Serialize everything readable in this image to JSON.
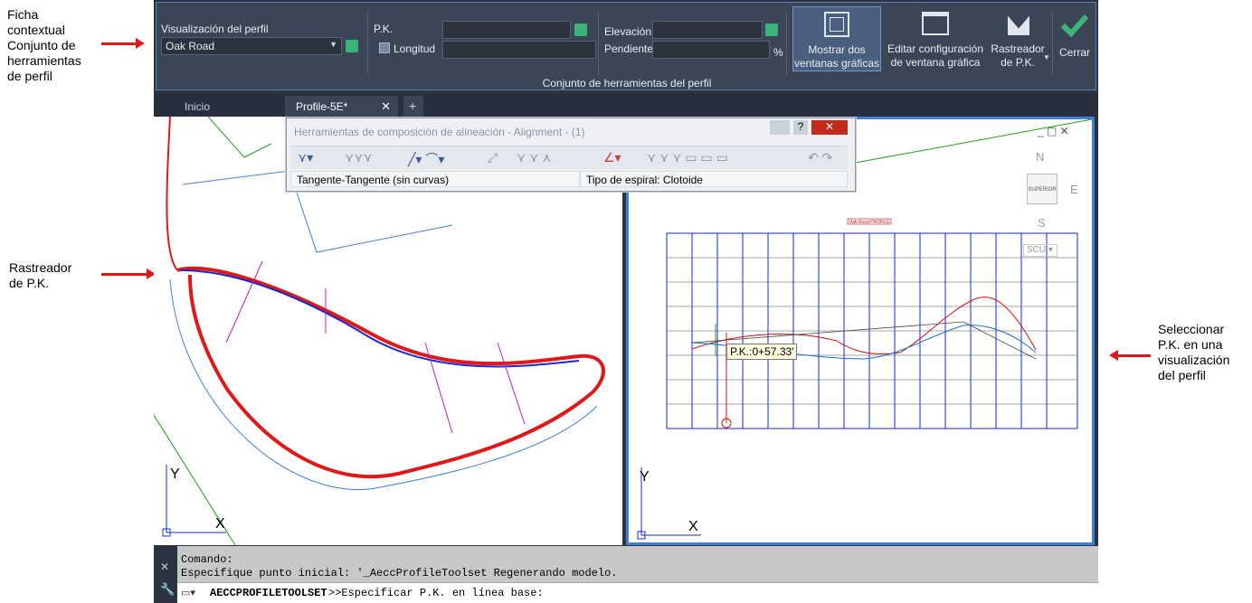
{
  "annotations": {
    "context_tab": "Ficha\ncontextual\nConjunto de\nherramientas\nde perfil",
    "station_tracker": "Rastreador\nde P.K.",
    "select_station": "Seleccionar\nP.K. en una\nvisualización\ndel perfil"
  },
  "ribbon": {
    "profile_view_label": "Visualización del perfil",
    "profile_view_value": "Oak Road",
    "station_label": "P.K.",
    "length_label": "Longitud",
    "elevation_label": "Elevación",
    "grade_label": "Pendiente",
    "grade_unit": "%",
    "show_two_viewports": "Mostrar dos\nventanas gráficas",
    "edit_viewport": "Editar configuración\nde ventana gráfica",
    "station_tracker": "Rastreador\nde P.K.",
    "close": "Cerrar",
    "panel_title": "Conjunto de herramientas del perfil"
  },
  "tabs": [
    {
      "label": "Inicio"
    },
    {
      "label": "Profile-5E*"
    }
  ],
  "toolbar": {
    "title": "Herramientas de composición de alineación - Alignment - (1)",
    "left_status": "Tangente-Tangente (sin curvas)",
    "right_status": "Tipo de espiral: Clotoide"
  },
  "viewcube": {
    "top": "SUPERIOR",
    "north": "N",
    "south": "S",
    "east": "E",
    "ucs": "SCU"
  },
  "station_tooltip": "P.K.:0+57.33'",
  "profile_title": "Oak Road PROFILE",
  "axes": {
    "y": "Y",
    "x": "X"
  },
  "command": {
    "line1": "Comando:",
    "line2": "Especifique punto inicial: '_AeccProfileToolset Regenerando modelo.",
    "prompt_cmd": "AECCPROFILETOOLSET",
    "prompt_text": " >>Especificar P.K. en línea base:"
  },
  "colors": {
    "accent": "#3f80d8",
    "annotation_arrow": "#e01818",
    "ribbon_bg": "#3a4556",
    "check": "#3cb37a"
  }
}
